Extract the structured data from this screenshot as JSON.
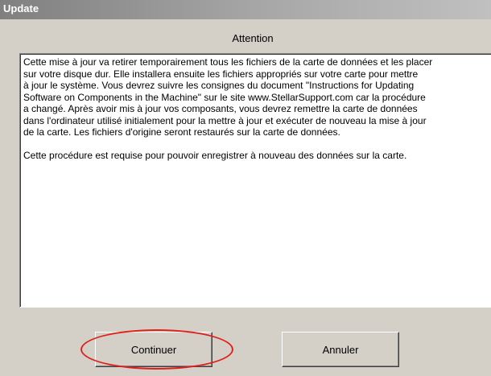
{
  "window": {
    "title": "Update"
  },
  "dialog": {
    "heading": "Attention",
    "message_paragraph_1": "Cette mise à jour va retirer temporairement tous les fichiers de la carte de données et les placer\nsur votre disque dur. Elle installera ensuite les fichiers appropriés sur votre carte pour mettre\nà jour le système.  Vous devrez suivre les consignes du document \"Instructions for Updating\nSoftware on Components in the Machine\" sur le site www.StellarSupport.com car la procédure\na changé.  Après avoir mis à jour vos composants, vous devrez remettre la carte de données\ndans l'ordinateur utilisé initialement pour la mettre à jour et exécuter de nouveau la mise à jour\nde la carte.  Les fichiers d'origine seront restaurés sur la carte de données.",
    "message_paragraph_2": "Cette procédure est requise pour pouvoir enregistrer à nouveau des données sur la carte."
  },
  "buttons": {
    "continue_label": "Continuer",
    "cancel_label": "Annuler"
  },
  "annotation": {
    "highlight_color": "#e0201a"
  }
}
